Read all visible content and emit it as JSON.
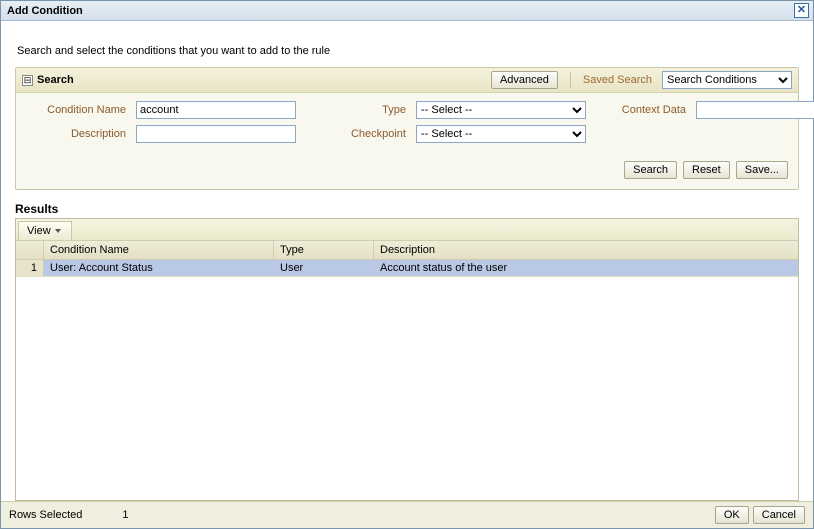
{
  "dialog": {
    "title": "Add Condition"
  },
  "intro": "Search and select the conditions that you want to add to the rule",
  "search": {
    "title": "Search",
    "toggle_glyph": "⊟",
    "advanced_btn": "Advanced",
    "saved_label": "Saved Search",
    "saved_value": "Search Conditions",
    "fields": {
      "condition_name_label": "Condition Name",
      "condition_name_value": "account",
      "description_label": "Description",
      "description_value": "",
      "type_label": "Type",
      "type_value": "-- Select --",
      "checkpoint_label": "Checkpoint",
      "checkpoint_value": "-- Select --",
      "context_label": "Context Data",
      "context_value": ""
    },
    "actions": {
      "search": "Search",
      "reset": "Reset",
      "save": "Save..."
    }
  },
  "results": {
    "title": "Results",
    "view_label": "View",
    "columns": {
      "rownum": "",
      "name": "Condition Name",
      "type": "Type",
      "desc": "Description"
    },
    "rows": [
      {
        "num": "1",
        "name": "User: Account Status",
        "type": "User",
        "desc": "Account status of the user"
      }
    ]
  },
  "footer": {
    "rows_selected_label": "Rows Selected",
    "rows_selected_count": "1",
    "ok": "OK",
    "cancel": "Cancel"
  }
}
